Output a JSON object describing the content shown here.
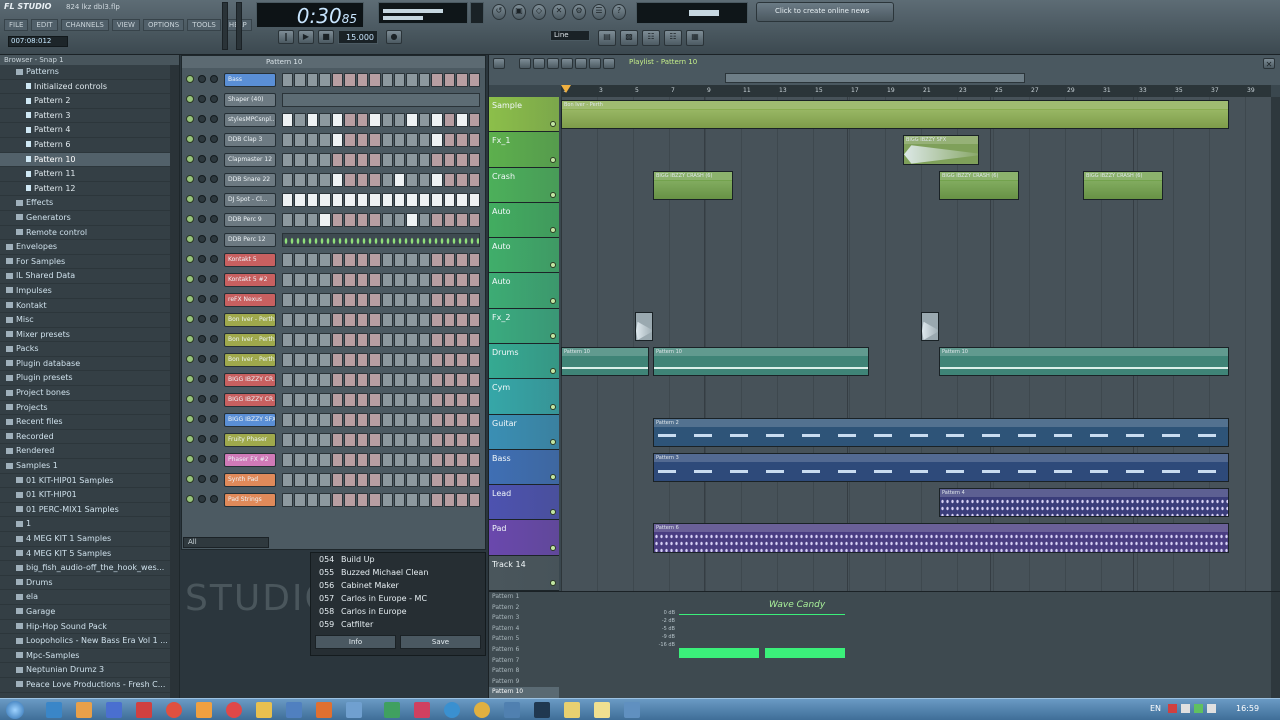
{
  "app": {
    "name": "FL STUDIO",
    "project": "824 lkz dbl3.flp",
    "time_display": "007:08:012",
    "clock_main": "0:30",
    "clock_sub": "85",
    "tempo": "15.000",
    "line_mode": "Line",
    "hint": "Click to create online news",
    "menu": [
      "FILE",
      "EDIT",
      "CHANNELS",
      "VIEW",
      "OPTIONS",
      "TOOLS",
      "HELP"
    ]
  },
  "browser": {
    "header": "Browser - Snap 1",
    "items": [
      {
        "label": "Patterns",
        "indent": 1,
        "type": "folder"
      },
      {
        "label": "Initialized controls",
        "indent": 2,
        "type": "item"
      },
      {
        "label": "Pattern 2",
        "indent": 2,
        "type": "item"
      },
      {
        "label": "Pattern 3",
        "indent": 2,
        "type": "item"
      },
      {
        "label": "Pattern 4",
        "indent": 2,
        "type": "item"
      },
      {
        "label": "Pattern 6",
        "indent": 2,
        "type": "item"
      },
      {
        "label": "Pattern 10",
        "indent": 2,
        "type": "item",
        "selected": true
      },
      {
        "label": "Pattern 11",
        "indent": 2,
        "type": "item"
      },
      {
        "label": "Pattern 12",
        "indent": 2,
        "type": "item"
      },
      {
        "label": "Effects",
        "indent": 1,
        "type": "folder"
      },
      {
        "label": "Generators",
        "indent": 1,
        "type": "folder"
      },
      {
        "label": "Remote control",
        "indent": 1,
        "type": "folder"
      },
      {
        "label": "Envelopes",
        "indent": 0,
        "type": "folder"
      },
      {
        "label": "For Samples",
        "indent": 0,
        "type": "folder"
      },
      {
        "label": "IL Shared Data",
        "indent": 0,
        "type": "folder"
      },
      {
        "label": "Impulses",
        "indent": 0,
        "type": "folder"
      },
      {
        "label": "Kontakt",
        "indent": 0,
        "type": "folder"
      },
      {
        "label": "Misc",
        "indent": 0,
        "type": "folder"
      },
      {
        "label": "Mixer presets",
        "indent": 0,
        "type": "folder"
      },
      {
        "label": "Packs",
        "indent": 0,
        "type": "folder"
      },
      {
        "label": "Plugin database",
        "indent": 0,
        "type": "folder"
      },
      {
        "label": "Plugin presets",
        "indent": 0,
        "type": "folder"
      },
      {
        "label": "Project bones",
        "indent": 0,
        "type": "folder"
      },
      {
        "label": "Projects",
        "indent": 0,
        "type": "folder"
      },
      {
        "label": "Recent files",
        "indent": 0,
        "type": "folder"
      },
      {
        "label": "Recorded",
        "indent": 0,
        "type": "folder"
      },
      {
        "label": "Rendered",
        "indent": 0,
        "type": "folder"
      },
      {
        "label": "Samples 1",
        "indent": 0,
        "type": "folder"
      },
      {
        "label": "01 KIT-HIP01 Samples",
        "indent": 1,
        "type": "folder"
      },
      {
        "label": "01 KIT-HIP01",
        "indent": 1,
        "type": "folder"
      },
      {
        "label": "01 PERC-MIX1 Samples",
        "indent": 1,
        "type": "folder"
      },
      {
        "label": "1",
        "indent": 1,
        "type": "folder"
      },
      {
        "label": "4 MEG KIT 1 Samples",
        "indent": 1,
        "type": "folder"
      },
      {
        "label": "4 MEG KIT 5 Samples",
        "indent": 1,
        "type": "folder"
      },
      {
        "label": "big_fish_audio-off_the_hook_wes...",
        "indent": 1,
        "type": "folder"
      },
      {
        "label": "Drums",
        "indent": 1,
        "type": "folder"
      },
      {
        "label": "ela",
        "indent": 1,
        "type": "folder"
      },
      {
        "label": "Garage",
        "indent": 1,
        "type": "folder"
      },
      {
        "label": "Hip-Hop Sound Pack",
        "indent": 1,
        "type": "folder"
      },
      {
        "label": "Loopoholics - New Bass Era Vol 1 ...",
        "indent": 1,
        "type": "folder"
      },
      {
        "label": "Mpc-Samples",
        "indent": 1,
        "type": "folder"
      },
      {
        "label": "Neptunian Drumz 3",
        "indent": 1,
        "type": "folder"
      },
      {
        "label": "Peace Love Productions - Fresh C...",
        "indent": 1,
        "type": "folder"
      }
    ]
  },
  "channel_rack": {
    "title": "Pattern 10",
    "filter": "All",
    "channels": [
      {
        "name": "Bass",
        "color": "#5a8fd6",
        "type": "steps",
        "on": [
          0,
          0,
          0,
          0,
          0,
          0,
          0,
          0,
          0,
          0,
          0,
          0,
          0,
          0,
          0,
          0
        ]
      },
      {
        "name": "Shaper (40)",
        "color": "#6d7a82",
        "type": "graph",
        "on": []
      },
      {
        "name": "stylesMPCsnpl...",
        "color": "#6d7a82",
        "type": "steps",
        "on": [
          1,
          0,
          1,
          0,
          1,
          0,
          0,
          1,
          0,
          0,
          1,
          0,
          1,
          0,
          1,
          0
        ]
      },
      {
        "name": "DDB Clap 3",
        "color": "#6d7a82",
        "type": "steps",
        "on": [
          0,
          0,
          0,
          0,
          1,
          0,
          0,
          0,
          0,
          0,
          0,
          0,
          1,
          0,
          0,
          0
        ]
      },
      {
        "name": "Clapmaster 12",
        "color": "#6d7a82",
        "type": "steps",
        "on": [
          0,
          0,
          0,
          0,
          0,
          0,
          0,
          0,
          0,
          0,
          0,
          0,
          0,
          0,
          0,
          0
        ]
      },
      {
        "name": "DDB Snare 22",
        "color": "#6d7a82",
        "type": "steps",
        "on": [
          0,
          0,
          0,
          0,
          1,
          0,
          0,
          0,
          0,
          1,
          0,
          0,
          1,
          0,
          0,
          0
        ]
      },
      {
        "name": "DJ Spot - Cl...",
        "color": "#6d7a82",
        "type": "steps",
        "on": [
          1,
          1,
          1,
          1,
          1,
          1,
          1,
          1,
          1,
          1,
          1,
          1,
          1,
          1,
          1,
          1
        ]
      },
      {
        "name": "DDB Perc 9",
        "color": "#6d7a82",
        "type": "steps",
        "on": [
          0,
          0,
          0,
          1,
          0,
          0,
          0,
          0,
          0,
          0,
          1,
          0,
          0,
          0,
          0,
          0
        ]
      },
      {
        "name": "DDB Perc 12",
        "color": "#6d7a82",
        "type": "graph-dots",
        "on": []
      },
      {
        "name": "Kontakt 5",
        "color": "#c86060",
        "type": "steps",
        "on": [
          0,
          0,
          0,
          0,
          0,
          0,
          0,
          0,
          0,
          0,
          0,
          0,
          0,
          0,
          0,
          0
        ]
      },
      {
        "name": "Kontakt 5 #2",
        "color": "#c86060",
        "type": "steps",
        "on": [
          0,
          0,
          0,
          0,
          0,
          0,
          0,
          0,
          0,
          0,
          0,
          0,
          0,
          0,
          0,
          0
        ]
      },
      {
        "name": "reFX Nexus",
        "color": "#c86060",
        "type": "steps",
        "on": [
          0,
          0,
          0,
          0,
          0,
          0,
          0,
          0,
          0,
          0,
          0,
          0,
          0,
          0,
          0,
          0
        ]
      },
      {
        "name": "Bon Iver - Perth",
        "color": "#9fa94c",
        "type": "steps",
        "on": [
          0,
          0,
          0,
          0,
          0,
          0,
          0,
          0,
          0,
          0,
          0,
          0,
          0,
          0,
          0,
          0
        ]
      },
      {
        "name": "Bon Iver - Perth",
        "color": "#9fa94c",
        "type": "steps",
        "on": [
          0,
          0,
          0,
          0,
          0,
          0,
          0,
          0,
          0,
          0,
          0,
          0,
          0,
          0,
          0,
          0
        ]
      },
      {
        "name": "Bon Iver - Perth",
        "color": "#9fa94c",
        "type": "steps",
        "on": [
          0,
          0,
          0,
          0,
          0,
          0,
          0,
          0,
          0,
          0,
          0,
          0,
          0,
          0,
          0,
          0
        ]
      },
      {
        "name": "BIGG IBZZY CR...",
        "color": "#c86060",
        "type": "steps",
        "on": [
          0,
          0,
          0,
          0,
          0,
          0,
          0,
          0,
          0,
          0,
          0,
          0,
          0,
          0,
          0,
          0
        ]
      },
      {
        "name": "BIGG IBZZY CR...",
        "color": "#c86060",
        "type": "steps",
        "on": [
          0,
          0,
          0,
          0,
          0,
          0,
          0,
          0,
          0,
          0,
          0,
          0,
          0,
          0,
          0,
          0
        ]
      },
      {
        "name": "BIGG IBZZY SFX",
        "color": "#5a8fd6",
        "type": "steps",
        "on": [
          0,
          0,
          0,
          0,
          0,
          0,
          0,
          0,
          0,
          0,
          0,
          0,
          0,
          0,
          0,
          0
        ]
      },
      {
        "name": "Fruity Phaser",
        "color": "#9fa94c",
        "type": "steps",
        "on": [
          0,
          0,
          0,
          0,
          0,
          0,
          0,
          0,
          0,
          0,
          0,
          0,
          0,
          0,
          0,
          0
        ]
      },
      {
        "name": "Phaser FX #2",
        "color": "#d07ab8",
        "type": "steps",
        "on": [
          0,
          0,
          0,
          0,
          0,
          0,
          0,
          0,
          0,
          0,
          0,
          0,
          0,
          0,
          0,
          0
        ]
      },
      {
        "name": "Synth Pad",
        "color": "#e08a5a",
        "type": "steps",
        "on": [
          0,
          0,
          0,
          0,
          0,
          0,
          0,
          0,
          0,
          0,
          0,
          0,
          0,
          0,
          0,
          0
        ]
      },
      {
        "name": "Pad Strings",
        "color": "#e08a5a",
        "type": "steps",
        "on": [
          0,
          0,
          0,
          0,
          0,
          0,
          0,
          0,
          0,
          0,
          0,
          0,
          0,
          0,
          0,
          0
        ]
      }
    ]
  },
  "plugin_menu": {
    "items": [
      {
        "num": "054",
        "label": "Build Up"
      },
      {
        "num": "055",
        "label": "Buzzed Michael Clean"
      },
      {
        "num": "056",
        "label": "Cabinet Maker"
      },
      {
        "num": "057",
        "label": "Carlos in Europe - MC"
      },
      {
        "num": "058",
        "label": "Carlos in Europe"
      },
      {
        "num": "059",
        "label": "Catfilter"
      }
    ],
    "info_label": "Info",
    "save_label": "Save"
  },
  "watermark": "STUDIO",
  "playlist": {
    "title": "Playlist - Pattern 10",
    "bars": [
      "1",
      "3",
      "5",
      "7",
      "9",
      "11",
      "13",
      "15",
      "17",
      "19",
      "21",
      "23",
      "25",
      "27",
      "29",
      "31",
      "33",
      "35",
      "37",
      "39"
    ],
    "tracks": [
      {
        "name": "Sample",
        "color": "#8cbf4a"
      },
      {
        "name": "Fx_1",
        "color": "#5db04d"
      },
      {
        "name": "Crash",
        "color": "#4cb05a"
      },
      {
        "name": "Auto",
        "color": "#42ad60"
      },
      {
        "name": "Auto",
        "color": "#40ae6a"
      },
      {
        "name": "Auto",
        "color": "#3dac74"
      },
      {
        "name": "Fx_2",
        "color": "#3aab7f"
      },
      {
        "name": "Drums",
        "color": "#35aa92"
      },
      {
        "name": "Cym",
        "color": "#36a7a8"
      },
      {
        "name": "Guitar",
        "color": "#3a8fb4"
      },
      {
        "name": "Bass",
        "color": "#3f6fb4"
      },
      {
        "name": "Lead",
        "color": "#4d52b0"
      },
      {
        "name": "Pad",
        "color": "#6a48ad"
      },
      {
        "name": "Track 14",
        "color": "#4a565c"
      }
    ],
    "clips": [
      {
        "track": 0,
        "start": 0,
        "len": 668,
        "label": "Bon Iver - Perth",
        "color": "#8cae52",
        "kind": "audio"
      },
      {
        "track": 1,
        "start": 342,
        "len": 76,
        "label": "BIGG IBZZY SFX",
        "color": "#7fa05a",
        "kind": "wave"
      },
      {
        "track": 2,
        "start": 92,
        "len": 80,
        "label": "BIGG IBZZY CRASH (6)",
        "color": "#73a24d",
        "kind": "audio"
      },
      {
        "track": 2,
        "start": 378,
        "len": 80,
        "label": "BIGG IBZZY CRASH (6)",
        "color": "#73a24d",
        "kind": "audio"
      },
      {
        "track": 2,
        "start": 522,
        "len": 80,
        "label": "BIGG IBZZY CRASH (6)",
        "color": "#73a24d",
        "kind": "audio"
      },
      {
        "track": 6,
        "start": 74,
        "len": 18,
        "label": "",
        "color": "#9aa9b0",
        "kind": "wave"
      },
      {
        "track": 6,
        "start": 360,
        "len": 18,
        "label": "",
        "color": "#9aa9b0",
        "kind": "wave"
      },
      {
        "track": 7,
        "start": 0,
        "len": 88,
        "label": "Pattern 10",
        "color": "#3f8477",
        "kind": "pattern"
      },
      {
        "track": 7,
        "start": 92,
        "len": 216,
        "label": "Pattern 10",
        "color": "#3f8477",
        "kind": "pattern"
      },
      {
        "track": 7,
        "start": 378,
        "len": 290,
        "label": "Pattern 10",
        "color": "#3f8477",
        "kind": "pattern"
      },
      {
        "track": 9,
        "start": 92,
        "len": 576,
        "label": "Pattern 2",
        "color": "#2e5478",
        "kind": "notes"
      },
      {
        "track": 10,
        "start": 92,
        "len": 576,
        "label": "Pattern 3",
        "color": "#2e4a7a",
        "kind": "notes"
      },
      {
        "track": 11,
        "start": 378,
        "len": 290,
        "label": "Pattern 4",
        "color": "#3a3d7a",
        "kind": "dense"
      },
      {
        "track": 12,
        "start": 92,
        "len": 576,
        "label": "Pattern 6",
        "color": "#4a3d82",
        "kind": "dense"
      }
    ]
  },
  "pattern_pane": {
    "items": [
      "Pattern 1",
      "Pattern 2",
      "Pattern 3",
      "Pattern 4",
      "Pattern 5",
      "Pattern 6",
      "Pattern 7",
      "Pattern 8",
      "Pattern 9",
      "Pattern 10"
    ],
    "selected": 9
  },
  "wave_candy": {
    "title": "Wave Candy",
    "db_labels": [
      "0 dB",
      "-2 dB",
      "-5 dB",
      "-9 dB",
      "-16 dB"
    ],
    "accent": "#3bf07a"
  },
  "taskbar": {
    "lang": "EN",
    "time": "16:59"
  }
}
